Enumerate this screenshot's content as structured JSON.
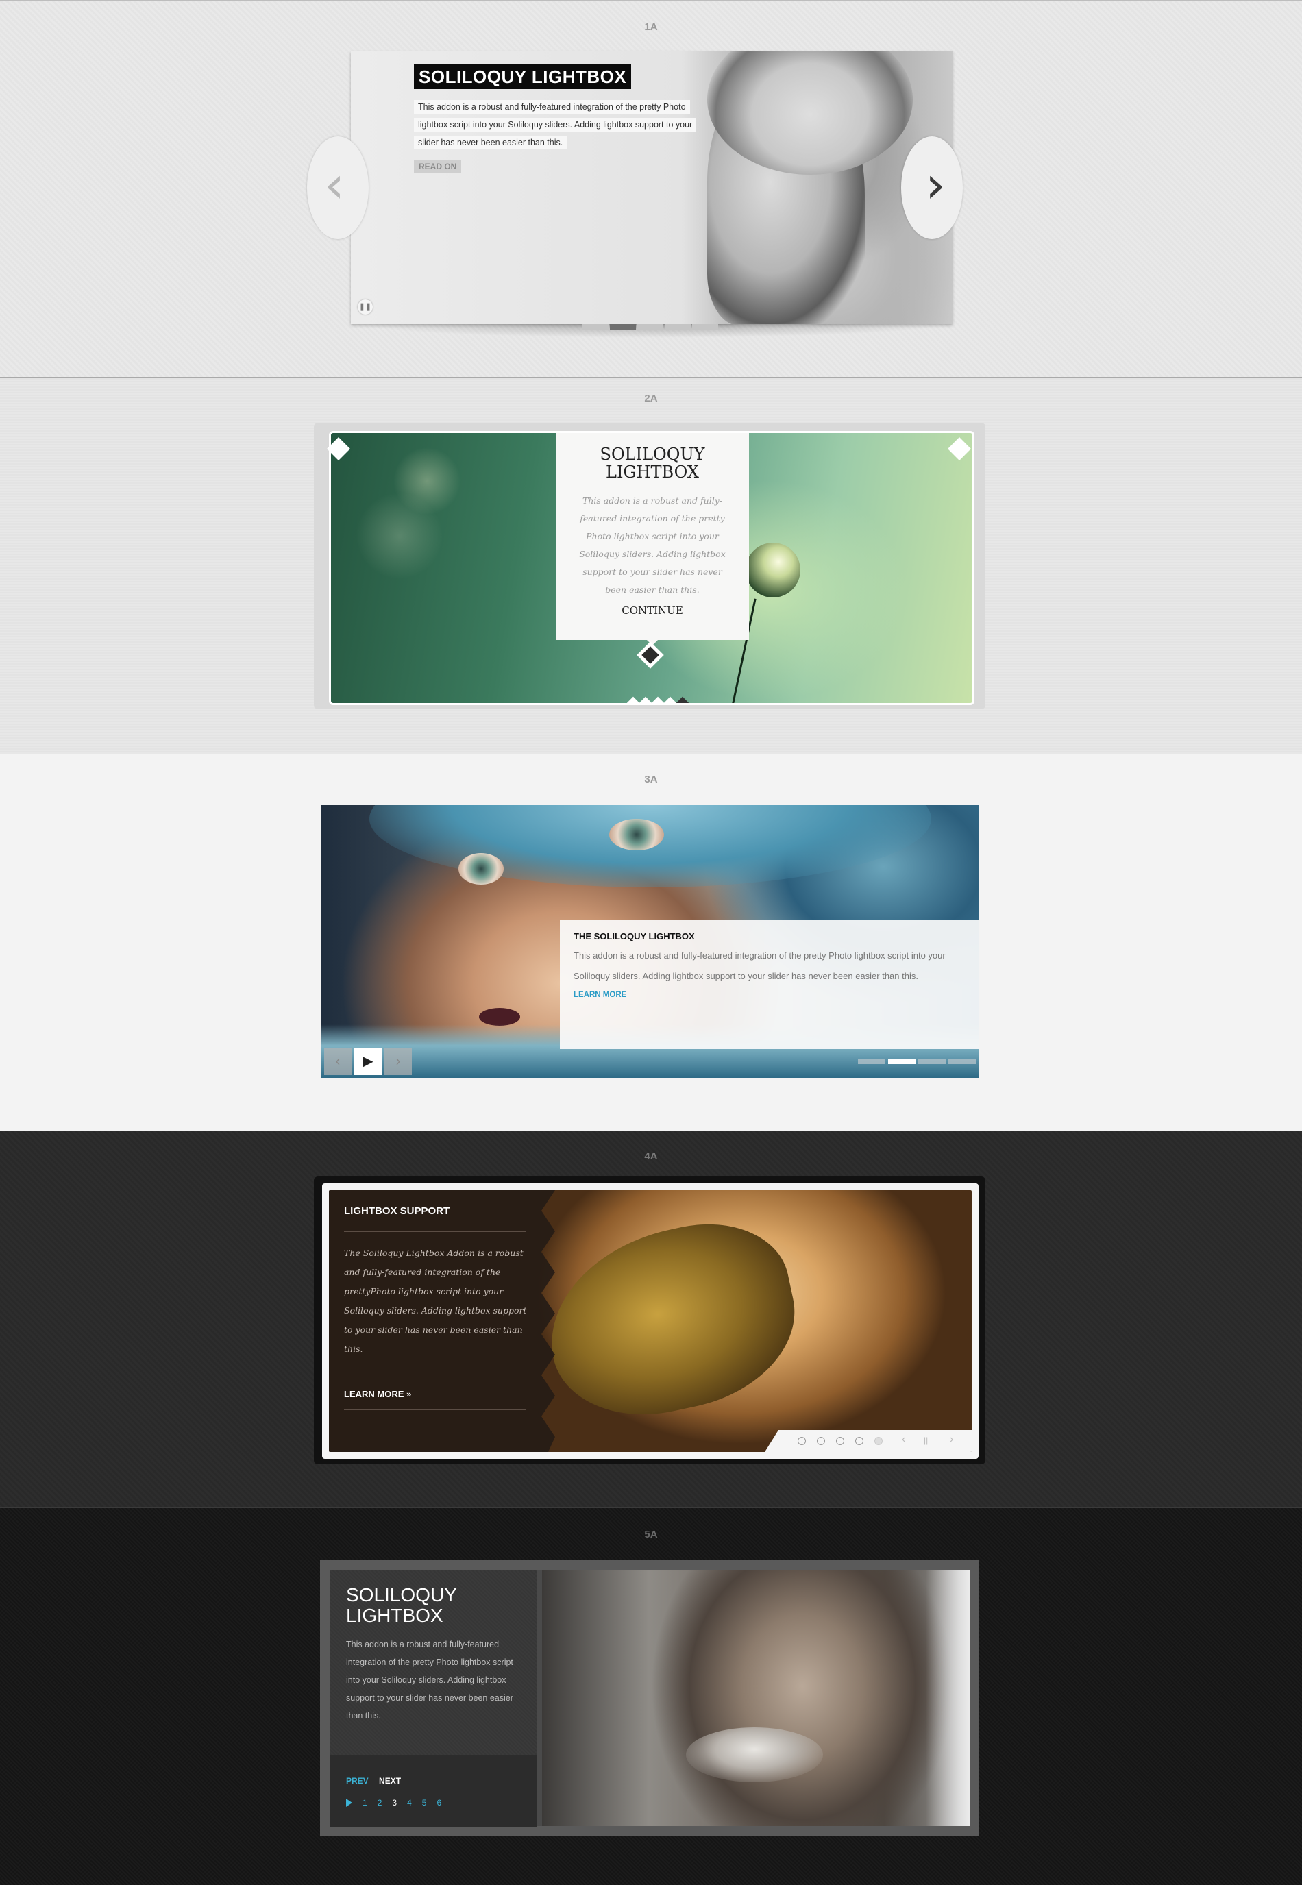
{
  "sections": [
    {
      "label": "1A",
      "title": "SOLILOQUY LIGHTBOX",
      "description": "This addon is a robust and fully-featured integration of the pretty Photo lightbox script into your Soliloquy sliders. Adding lightbox support to your slider has never been easier than this.",
      "cta": "READ ON",
      "pause_icon": "pause-icon",
      "prev_icon": "chevron-left-icon",
      "next_icon": "chevron-right-icon",
      "pager_count": 5,
      "pager_active": 2
    },
    {
      "label": "2A",
      "title": "SOLILOQUY LIGHTBOX",
      "description": "This addon is a robust and fully-featured integration of the pretty Photo lightbox script into your Soliloquy sliders. Adding lightbox support to your slider has never been easier than this.",
      "cta": "CONTINUE"
    },
    {
      "label": "3A",
      "title": "THE SOLILOQUY LIGHTBOX",
      "description": "This addon is a robust and fully-featured integration of the pretty Photo lightbox script into your Soliloquy sliders. Adding lightbox support to your slider has never been easier than this.",
      "cta": "LEARN MORE",
      "controls": {
        "prev": "‹",
        "play": "▶",
        "next": "›"
      },
      "pager_count": 4,
      "pager_active": 2
    },
    {
      "label": "4A",
      "title": "LIGHTBOX SUPPORT",
      "description": "The Soliloquy Lightbox Addon is a robust and fully-featured integration of the prettyPhoto lightbox script into your Soliloquy sliders. Adding lightbox support to your slider has never been easier than this.",
      "cta": "LEARN MORE »",
      "controls": {
        "prev": "‹",
        "pause": "||",
        "next": "›"
      },
      "pager_count": 5,
      "pager_active": 5
    },
    {
      "label": "5A",
      "title": "SOLILOQUY LIGHTBOX",
      "description": "This addon is a robust and fully-featured integration of the pretty Photo lightbox script into your Soliloquy sliders. Adding lightbox support to your slider has never been easier than this.",
      "prev": "PREV",
      "next": "NEXT",
      "pages": [
        "1",
        "2",
        "3",
        "4",
        "5",
        "6"
      ],
      "current_page": "3",
      "colors": {
        "accent": "#3bb3d6"
      }
    }
  ],
  "s1_title_lines": [
    "SOLILOQUY LIGHTBOX"
  ],
  "s2_title_lines": [
    "SOLILOQUY",
    "LIGHTBOX"
  ],
  "s5_title_lines": [
    "SOLILOQUY",
    "LIGHTBOX"
  ],
  "s1_desc_lines": [
    "This addon is a robust and fully-featured integration of the pretty Photo",
    "lightbox script into your Soliloquy sliders. Adding lightbox support to your",
    "slider has never been easier than this."
  ]
}
